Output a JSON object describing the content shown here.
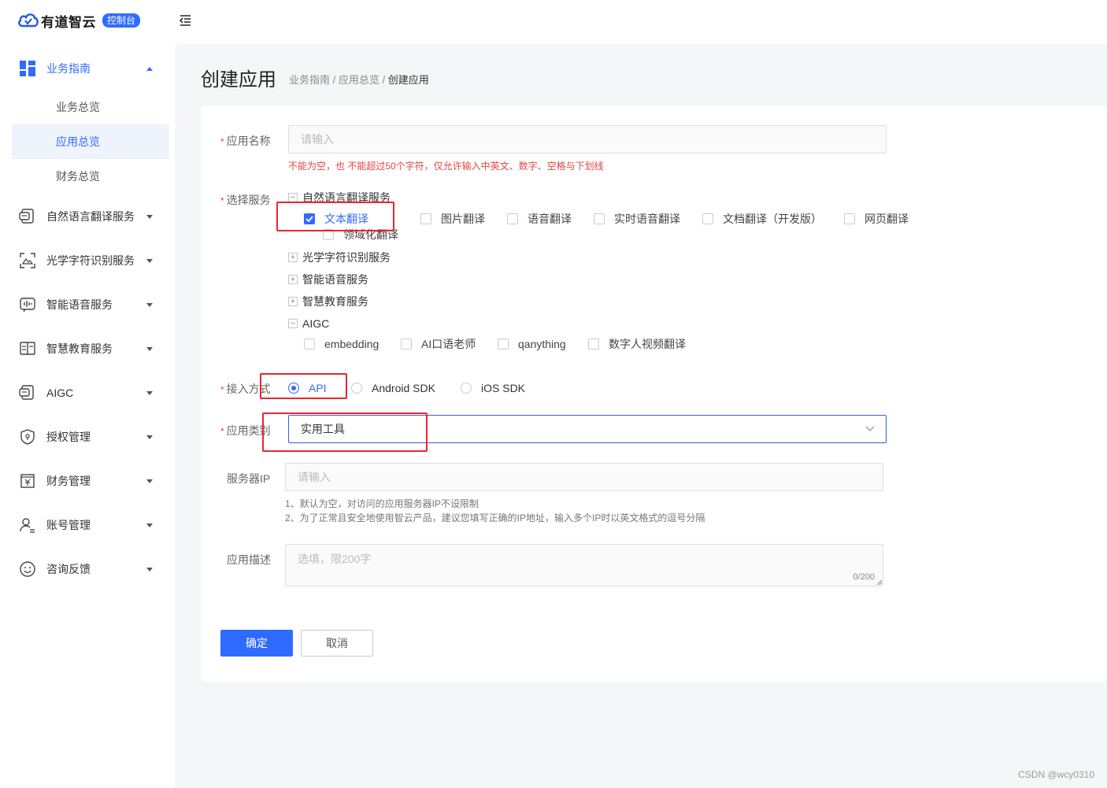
{
  "header": {
    "brand": "有道智云",
    "badge": "控制台"
  },
  "sidebar": {
    "groups": [
      {
        "label": "业务指南",
        "icon": "grid-icon",
        "open": true
      },
      {
        "label": "自然语言翻译服务",
        "icon": "translate-doc-icon"
      },
      {
        "label": "光学字符识别服务",
        "icon": "scan-icon"
      },
      {
        "label": "智能语音服务",
        "icon": "voice-icon"
      },
      {
        "label": "智慧教育服务",
        "icon": "book-icon"
      },
      {
        "label": "AIGC",
        "icon": "aigc-icon"
      },
      {
        "label": "授权管理",
        "icon": "shield-icon"
      },
      {
        "label": "财务管理",
        "icon": "finance-icon"
      },
      {
        "label": "账号管理",
        "icon": "user-icon"
      },
      {
        "label": "咨询反馈",
        "icon": "smile-icon"
      }
    ],
    "sub_items": [
      {
        "label": "业务总览"
      },
      {
        "label": "应用总览",
        "active": true
      },
      {
        "label": "财务总览"
      }
    ]
  },
  "page": {
    "title": "创建应用",
    "breadcrumb": {
      "part1": "业务指南",
      "sep1": " / ",
      "part2": "应用总览",
      "sep2": " / ",
      "current": "创建应用"
    }
  },
  "form": {
    "app_name": {
      "label": "应用名称",
      "placeholder": "请输入",
      "error": "不能为空，也 不能超过50个字符，仅允许输入中英文、数字、空格与下划线"
    },
    "services": {
      "label": "选择服务",
      "tree": [
        {
          "label": "自然语言翻译服务",
          "expanded": true
        },
        {
          "label": "光学字符识别服务",
          "expanded": false
        },
        {
          "label": "智能语音服务",
          "expanded": false
        },
        {
          "label": "智慧教育服务",
          "expanded": false
        },
        {
          "label": "AIGC",
          "expanded": true
        }
      ],
      "nlp_options": [
        {
          "label": "文本翻译",
          "checked": true
        },
        {
          "label": "图片翻译"
        },
        {
          "label": "语音翻译"
        },
        {
          "label": "实时语音翻译"
        },
        {
          "label": "文档翻译（开发版）"
        },
        {
          "label": "网页翻译"
        }
      ],
      "nlp_sub": {
        "label": "领域化翻译"
      },
      "aigc_options": [
        {
          "label": "embedding"
        },
        {
          "label": "AI口语老师"
        },
        {
          "label": "qanything"
        },
        {
          "label": "数字人视频翻译"
        }
      ]
    },
    "access": {
      "label": "接入方式",
      "options": [
        {
          "label": "API",
          "selected": true
        },
        {
          "label": "Android SDK"
        },
        {
          "label": "iOS SDK"
        }
      ]
    },
    "category": {
      "label": "应用类别",
      "value": "实用工具"
    },
    "server_ip": {
      "label": "服务器IP",
      "placeholder": "请输入",
      "hint1": "1、默认为空，对访问的应用服务器IP不设限制",
      "hint2": "2、为了正常且安全地使用智云产品，建议您填写正确的IP地址，输入多个IP时以英文格式的逗号分隔"
    },
    "description": {
      "label": "应用描述",
      "placeholder": "选填，限200字",
      "counter": "0/200"
    },
    "confirm_label": "确定",
    "cancel_label": "取消"
  },
  "watermark": "CSDN @wcy0310",
  "colors": {
    "accent": "#2f6bff",
    "error": "#e54545",
    "highlight_box": "#e8262e"
  }
}
